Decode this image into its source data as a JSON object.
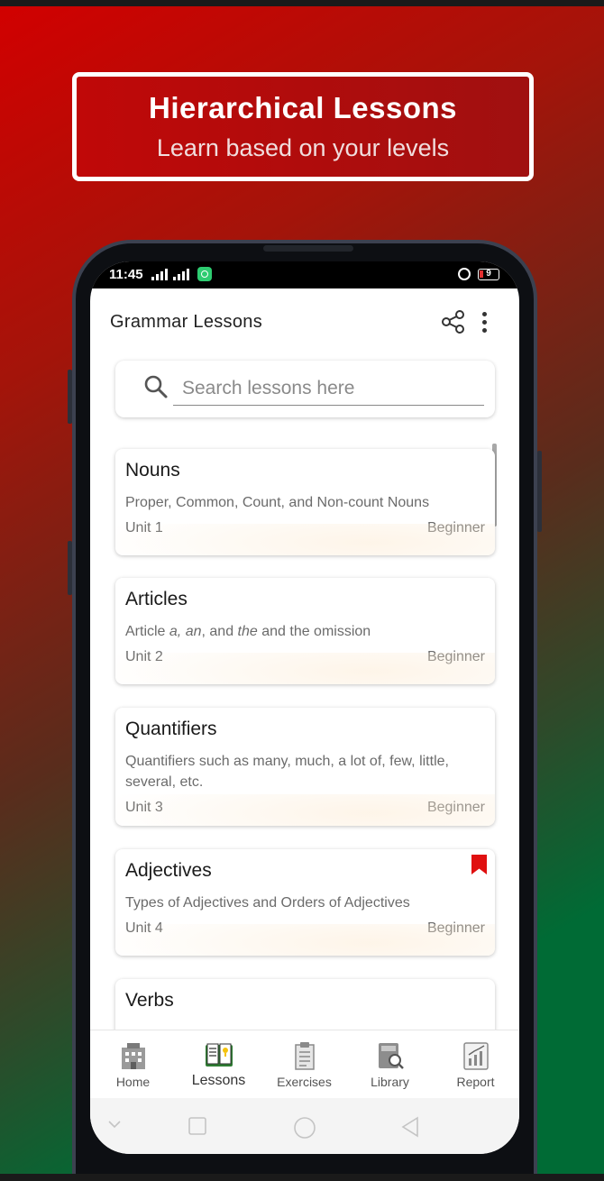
{
  "banner": {
    "title": "Hierarchical Lessons",
    "subtitle": "Learn based on your levels"
  },
  "status_bar": {
    "time": "11:45",
    "battery": "9"
  },
  "app_bar": {
    "title": "Grammar Lessons",
    "share_icon": "share-icon",
    "menu_icon": "more-vert-icon"
  },
  "search": {
    "placeholder": "Search lessons here",
    "value": ""
  },
  "lessons": [
    {
      "title": "Nouns",
      "description": "Proper, Common, Count, and Non-count Nouns",
      "unit": "Unit 1",
      "level": "Beginner",
      "bookmarked": false
    },
    {
      "title": "Articles",
      "description_parts": [
        "Article ",
        "a, an",
        ", and ",
        "the",
        " and the omission"
      ],
      "unit": "Unit 2",
      "level": "Beginner",
      "bookmarked": false
    },
    {
      "title": "Quantifiers",
      "description": "Quantifiers such as many, much, a lot of, few, little, several, etc.",
      "unit": "Unit 3",
      "level": "Beginner",
      "bookmarked": false
    },
    {
      "title": "Adjectives",
      "description": "Types of Adjectives and Orders of Adjectives",
      "unit": "Unit 4",
      "level": "Beginner",
      "bookmarked": true
    },
    {
      "title": "Verbs"
    }
  ],
  "bottom_nav": {
    "items": [
      {
        "label": "Home",
        "icon": "building-icon",
        "active": false
      },
      {
        "label": "Lessons",
        "icon": "book-icon",
        "active": true
      },
      {
        "label": "Exercises",
        "icon": "clipboard-icon",
        "active": false
      },
      {
        "label": "Library",
        "icon": "library-book-icon",
        "active": false
      },
      {
        "label": "Report",
        "icon": "chart-report-icon",
        "active": false
      }
    ]
  },
  "colors": {
    "bookmark": "#e01010",
    "active_icon": "#2e7d32",
    "banner_border": "#ffffff"
  }
}
